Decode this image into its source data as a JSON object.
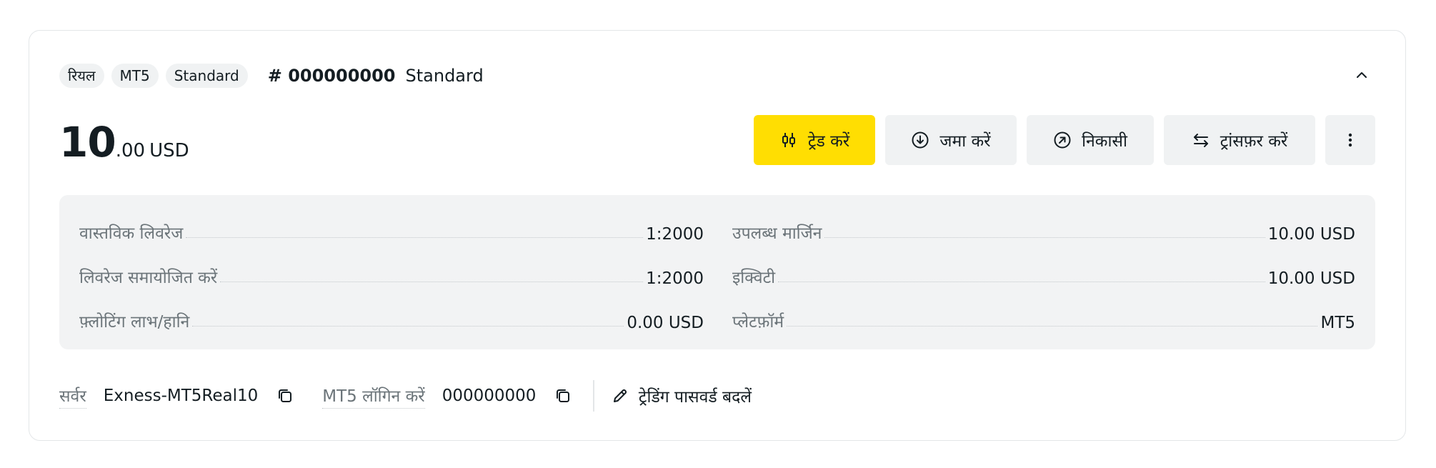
{
  "account": {
    "tags": [
      "रियल",
      "MT5",
      "Standard"
    ],
    "number": "# 000000000",
    "type": "Standard"
  },
  "balance": {
    "integer": "10",
    "decimal": ".00",
    "currency": "USD"
  },
  "actions": {
    "trade": "ट्रेड करें",
    "deposit": "जमा करें",
    "withdraw": "निकासी",
    "transfer": "ट्रांसफ़र करें"
  },
  "stats": {
    "left": [
      {
        "label": "वास्तविक लिवरेज",
        "value": "1:2000"
      },
      {
        "label": "लिवरेज समायोजित करें",
        "value": "1:2000"
      },
      {
        "label": "फ़्लोटिंग लाभ/हानि",
        "value": "0.00 USD"
      }
    ],
    "right": [
      {
        "label": "उपलब्ध मार्जिन",
        "value": "10.00 USD"
      },
      {
        "label": "इक्विटी",
        "value": "10.00 USD"
      },
      {
        "label": "प्लेटफ़ॉर्म",
        "value": "MT5"
      }
    ]
  },
  "footer": {
    "server_label": "सर्वर",
    "server_value": "Exness-MT5Real10",
    "login_label": "MT5 लॉगिन करें",
    "login_value": "000000000",
    "change_password": "ट्रेडिंग पासवर्ड बदलें"
  },
  "icons": {
    "trade": "candlestick-icon",
    "deposit": "arrow-down-circle-icon",
    "withdraw": "arrow-up-right-circle-icon",
    "transfer": "transfer-arrows-icon",
    "more": "more-vertical-icon",
    "collapse": "chevron-up-icon",
    "copy": "copy-icon",
    "edit": "pencil-icon"
  },
  "colors": {
    "primary": "#ffde02",
    "button_bg": "#f0f2f3",
    "panel_bg": "#f2f3f4",
    "text": "#141d22",
    "muted": "#6b7479"
  }
}
